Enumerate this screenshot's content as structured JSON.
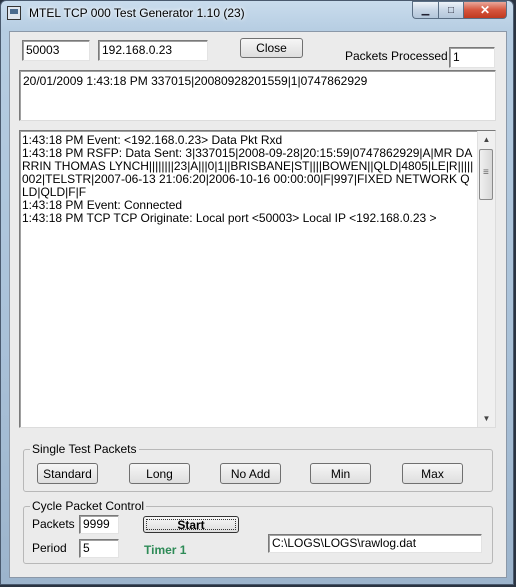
{
  "window": {
    "title": "MTEL TCP 000 Test Generator 1.10 (23)"
  },
  "connection": {
    "port": "50003",
    "ip": "192.168.0.23",
    "close_label": "Close"
  },
  "packets_processed": {
    "label": "Packets Processed",
    "value": "1"
  },
  "summary_text": "20/01/2009 1:43:18 PM 337015|20080928201559|1|0747862929",
  "log": [
    "1:43:18 PM Event: <192.168.0.23> Data Pkt Rxd",
    "1:43:18 PM RSFP: Data Sent: 3|337015|2008-09-28|20:15:59|0747862929|A|MR DARRIN THOMAS LYNCH||||||||23|A|||0|1||BRISBANE|ST||||BOWEN||QLD|4805|LE|R|||||002|TELSTR|2007-06-13 21:06:20|2006-10-16 00:00:00|F|997|FIXED NETWORK QLD|QLD|F|F",
    "1:43:18 PM Event: Connected",
    "1:43:18 PM TCP TCP Originate: Local port <50003> Local IP <192.168.0.23 >"
  ],
  "single_test": {
    "title": "Single Test Packets",
    "buttons": [
      "Standard",
      "Long",
      "No Add",
      "Min",
      "Max"
    ]
  },
  "cycle": {
    "title": "Cycle Packet Control",
    "packets_label": "Packets",
    "packets_value": "9999",
    "period_label": "Period",
    "period_value": "5",
    "start_label": "Start",
    "timer_label": "Timer 1",
    "log_path": "C:\\LOGS\\LOGS\\rawlog.dat"
  },
  "colors": {
    "timer": "#2e8b57"
  }
}
